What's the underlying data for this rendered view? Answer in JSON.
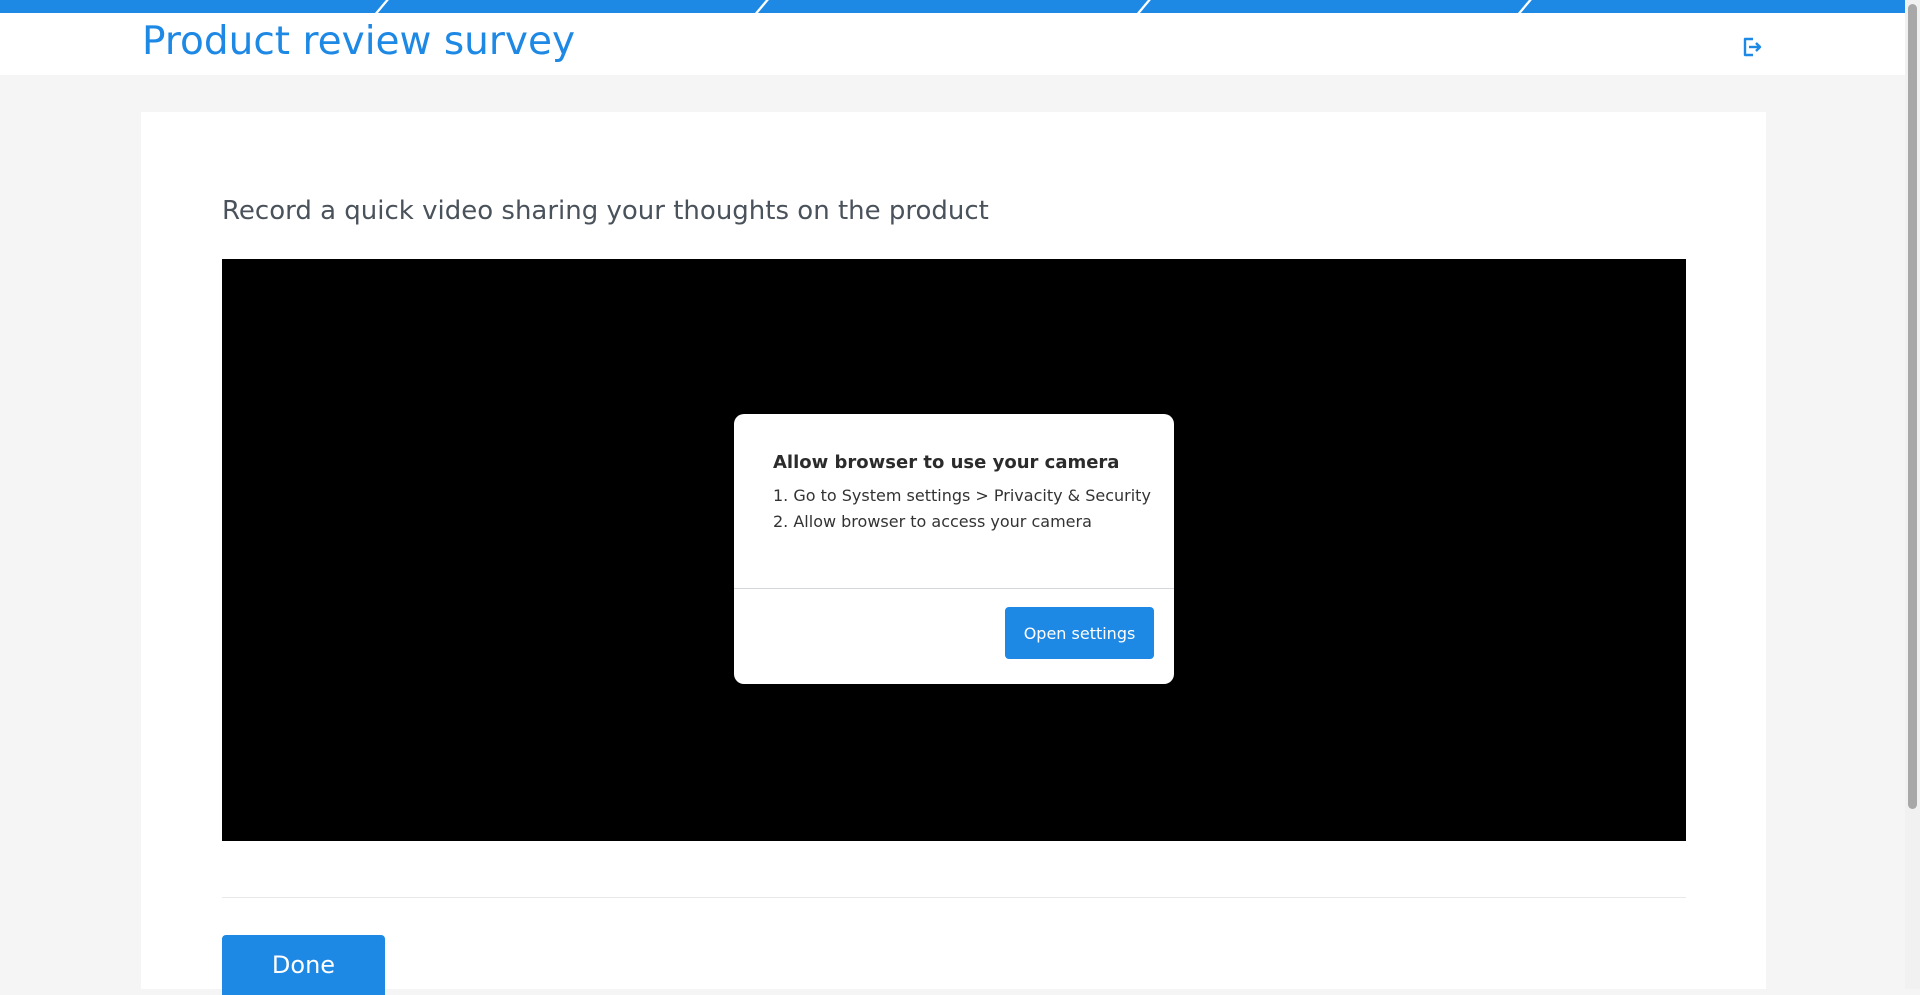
{
  "header": {
    "title": "Product review survey",
    "exit_icon": "exit-icon"
  },
  "survey": {
    "question": "Record a quick video sharing your thoughts on the product",
    "done_label": "Done"
  },
  "dialog": {
    "title": "Allow browser to use your camera",
    "steps": [
      "1. Go to System settings > Privacity & Security",
      "2. Allow browser to access your camera"
    ],
    "button_label": "Open settings"
  },
  "colors": {
    "accent": "#1e88e5",
    "page_background": "#f5f5f5",
    "video_background": "#000000"
  }
}
